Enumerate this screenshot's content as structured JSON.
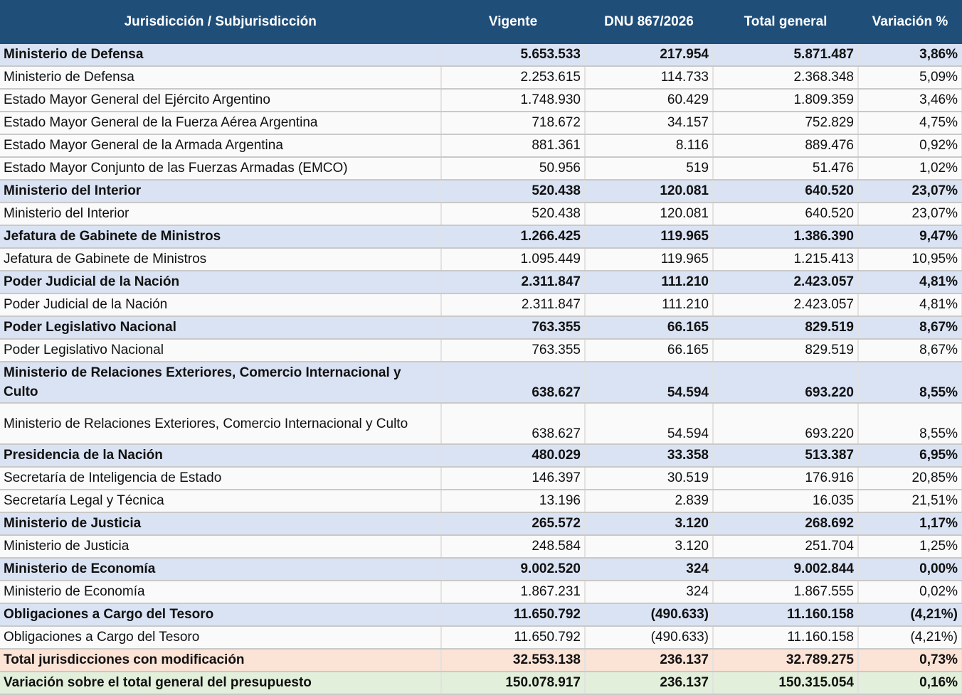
{
  "headers": {
    "name": "Jurisdicción / Subjurisdicción",
    "vigente": "Vigente",
    "dnu": "DNU 867/2026",
    "total": "Total general",
    "variacion": "Variación %"
  },
  "rows": [
    {
      "type": "group",
      "name": "Ministerio de Defensa",
      "vigente": "5.653.533",
      "dnu": "217.954",
      "total": "5.871.487",
      "variacion": "3,86%"
    },
    {
      "type": "sub",
      "name": "Ministerio de Defensa",
      "vigente": "2.253.615",
      "dnu": "114.733",
      "total": "2.368.348",
      "variacion": "5,09%"
    },
    {
      "type": "sub",
      "name": "Estado Mayor General del Ejército Argentino",
      "vigente": "1.748.930",
      "dnu": "60.429",
      "total": "1.809.359",
      "variacion": "3,46%"
    },
    {
      "type": "sub",
      "name": "Estado Mayor General de la Fuerza Aérea Argentina",
      "vigente": "718.672",
      "dnu": "34.157",
      "total": "752.829",
      "variacion": "4,75%"
    },
    {
      "type": "sub",
      "name": "Estado Mayor General de la Armada Argentina",
      "vigente": "881.361",
      "dnu": "8.116",
      "total": "889.476",
      "variacion": "0,92%"
    },
    {
      "type": "sub",
      "name": "Estado Mayor Conjunto de las Fuerzas Armadas (EMCO)",
      "vigente": "50.956",
      "dnu": "519",
      "total": "51.476",
      "variacion": "1,02%"
    },
    {
      "type": "group",
      "name": "Ministerio del Interior",
      "vigente": "520.438",
      "dnu": "120.081",
      "total": "640.520",
      "variacion": "23,07%"
    },
    {
      "type": "sub",
      "name": "Ministerio del Interior",
      "vigente": "520.438",
      "dnu": "120.081",
      "total": "640.520",
      "variacion": "23,07%"
    },
    {
      "type": "group",
      "name": "Jefatura de Gabinete de Ministros",
      "vigente": "1.266.425",
      "dnu": "119.965",
      "total": "1.386.390",
      "variacion": "9,47%"
    },
    {
      "type": "sub",
      "name": "Jefatura de Gabinete de Ministros",
      "vigente": "1.095.449",
      "dnu": "119.965",
      "total": "1.215.413",
      "variacion": "10,95%"
    },
    {
      "type": "group",
      "name": "Poder Judicial de la Nación",
      "vigente": "2.311.847",
      "dnu": "111.210",
      "total": "2.423.057",
      "variacion": "4,81%"
    },
    {
      "type": "sub",
      "name": "Poder Judicial de la Nación",
      "vigente": "2.311.847",
      "dnu": "111.210",
      "total": "2.423.057",
      "variacion": "4,81%"
    },
    {
      "type": "group",
      "name": "Poder Legislativo Nacional",
      "vigente": "763.355",
      "dnu": "66.165",
      "total": "829.519",
      "variacion": "8,67%"
    },
    {
      "type": "sub",
      "name": "Poder Legislativo Nacional",
      "vigente": "763.355",
      "dnu": "66.165",
      "total": "829.519",
      "variacion": "8,67%"
    },
    {
      "type": "group tall",
      "name": "Ministerio de Relaciones Exteriores, Comercio Internacional y Culto",
      "vigente": "638.627",
      "dnu": "54.594",
      "total": "693.220",
      "variacion": "8,55%"
    },
    {
      "type": "sub tall",
      "name": "Ministerio de Relaciones Exteriores, Comercio Internacional y Culto",
      "vigente": "638.627",
      "dnu": "54.594",
      "total": "693.220",
      "variacion": "8,55%"
    },
    {
      "type": "group",
      "name": "Presidencia de la Nación",
      "vigente": "480.029",
      "dnu": "33.358",
      "total": "513.387",
      "variacion": "6,95%"
    },
    {
      "type": "sub",
      "name": "Secretaría de Inteligencia de Estado",
      "vigente": "146.397",
      "dnu": "30.519",
      "total": "176.916",
      "variacion": "20,85%"
    },
    {
      "type": "sub",
      "name": "Secretaría Legal y Técnica",
      "vigente": "13.196",
      "dnu": "2.839",
      "total": "16.035",
      "variacion": "21,51%"
    },
    {
      "type": "group",
      "name": "Ministerio de Justicia",
      "vigente": "265.572",
      "dnu": "3.120",
      "total": "268.692",
      "variacion": "1,17%"
    },
    {
      "type": "sub",
      "name": "Ministerio de Justicia",
      "vigente": "248.584",
      "dnu": "3.120",
      "total": "251.704",
      "variacion": "1,25%"
    },
    {
      "type": "group",
      "name": "Ministerio de Economía",
      "vigente": "9.002.520",
      "dnu": "324",
      "total": "9.002.844",
      "variacion": "0,00%"
    },
    {
      "type": "sub",
      "name": "Ministerio de Economía",
      "vigente": "1.867.231",
      "dnu": "324",
      "total": "1.867.555",
      "variacion": "0,02%"
    },
    {
      "type": "group",
      "name": "Obligaciones a Cargo del Tesoro",
      "vigente": "11.650.792",
      "dnu": "(490.633)",
      "total": "11.160.158",
      "variacion": "(4,21%)"
    },
    {
      "type": "sub",
      "name": "Obligaciones a Cargo del Tesoro",
      "vigente": "11.650.792",
      "dnu": "(490.633)",
      "total": "11.160.158",
      "variacion": "(4,21%)"
    },
    {
      "type": "total",
      "name": "Total jurisdicciones con modificación",
      "vigente": "32.553.138",
      "dnu": "236.137",
      "total": "32.789.275",
      "variacion": "0,73%"
    },
    {
      "type": "grand",
      "name": "Variación sobre el total general del presupuesto",
      "vigente": "150.078.917",
      "dnu": "236.137",
      "total": "150.315.054",
      "variacion": "0,16%"
    }
  ]
}
